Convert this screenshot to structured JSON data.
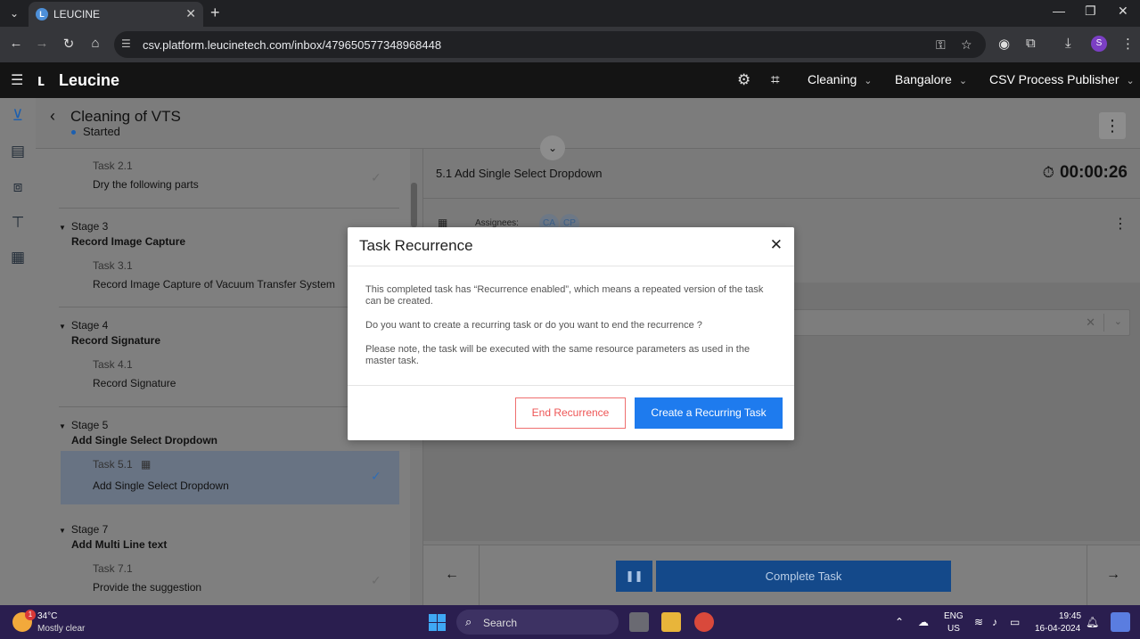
{
  "browser": {
    "tab_title": "LEUCINE",
    "url": "csv.platform.leucinetech.com/inbox/479650577348968448",
    "profile_initial": "S"
  },
  "app": {
    "logo_text": "Leucine",
    "dropdowns": [
      "Cleaning",
      "Bangalore",
      "CSV Process Publisher"
    ]
  },
  "job": {
    "title": "Cleaning of VTS",
    "status": "Started"
  },
  "stages": [
    {
      "tasks": [
        {
          "no": "Task 2.1",
          "name": "Dry the following parts",
          "done": true
        }
      ]
    },
    {
      "label": "Stage 3",
      "name": "Record Image Capture",
      "tasks": [
        {
          "no": "Task 3.1",
          "name": "Record Image Capture of Vacuum Transfer System",
          "done": false
        }
      ]
    },
    {
      "label": "Stage 4",
      "name": "Record Signature",
      "tasks": [
        {
          "no": "Task 4.1",
          "name": "Record Signature",
          "done": false
        }
      ]
    },
    {
      "label": "Stage 5",
      "name": "Add Single Select Dropdown",
      "tasks": [
        {
          "no": "Task 5.1",
          "name": "Add Single Select Dropdown",
          "done": true,
          "selected": true
        }
      ]
    },
    {
      "label": "Stage 7",
      "name": "Add Multi Line text",
      "tasks": [
        {
          "no": "Task 7.1",
          "name": "Provide the suggestion",
          "done": true
        }
      ]
    }
  ],
  "task_panel": {
    "title": "5.1 Add Single Select Dropdown",
    "timer": "00:00:26",
    "assignees_label": "Assignees:",
    "assignees": [
      "CA",
      "CP"
    ],
    "complete_label": "Complete Task"
  },
  "modal": {
    "title": "Task Recurrence",
    "p1": "This completed task has “Recurrence enabled”, which means a repeated version of the task can be created.",
    "p2": "Do you want to create a recurring task or do you want to end the recurrence ?",
    "p3": "Please note, the task will be executed with the same resource parameters as used in the master task.",
    "end_label": "End Recurrence",
    "create_label": "Create a Recurring Task"
  },
  "taskbar": {
    "temp": "34°C",
    "weather": "Mostly clear",
    "weather_badge": "1",
    "search": "Search",
    "lang1": "ENG",
    "lang2": "US",
    "time": "19:45",
    "date": "16-04-2024"
  }
}
